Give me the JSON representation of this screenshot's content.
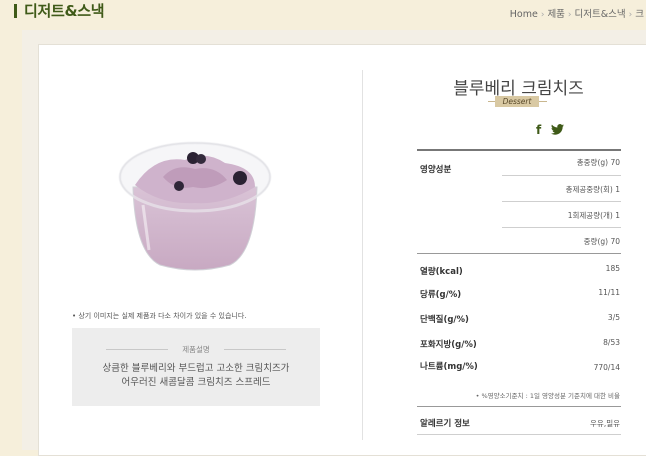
{
  "header": {
    "title": "디저트&스낵",
    "breadcrumb": [
      "Home",
      "제품",
      "디저트&스낵",
      "크"
    ]
  },
  "product": {
    "name": "블루베리 크림치즈",
    "category_tag": "Dessert",
    "image_note": "• 상기 이미지는 실제 제품과 다소 차이가 있을 수 있습니다.",
    "desc_label": "제품설명",
    "desc_line1": "상큼한 블루베리와 부드럽고 고소한 크림치즈가",
    "desc_line2": "어우러진 새콤달콤 크림치즈 스프레드"
  },
  "social": {
    "facebook": "f",
    "twitter": "🐦"
  },
  "nutrition": {
    "section_label": "영양성분",
    "serving": [
      "총중량(g) 70",
      "총제공중량(회) 1",
      "1회제공량(개) 1",
      "중량(g) 70"
    ],
    "rows": [
      {
        "label": "열량(kcal)",
        "value": "185"
      },
      {
        "label": "당류(g/%)",
        "value": "11/11"
      },
      {
        "label": "단백질(g/%)",
        "value": "3/5"
      },
      {
        "label": "포화지방(g/%)",
        "value": "8/53"
      },
      {
        "label": "나트륨(mg/%)",
        "value": "770/14"
      }
    ],
    "footnote": "• %영양소기준치 : 1일 영양성분 기준치에 대한 비율",
    "allergy_label": "알레르기 정보",
    "allergy_value": "우유,밀유"
  },
  "colors": {
    "brand_green": "#3f5a18",
    "background": "#f6efdb"
  }
}
